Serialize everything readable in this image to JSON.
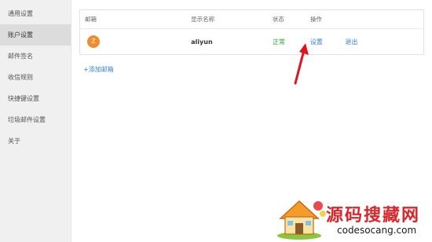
{
  "sidebar": {
    "items": [
      {
        "label": "通用设置"
      },
      {
        "label": "账户设置"
      },
      {
        "label": "邮件签名"
      },
      {
        "label": "收信规则"
      },
      {
        "label": "快捷键设置"
      },
      {
        "label": "垃圾邮件设置"
      },
      {
        "label": "关于"
      }
    ],
    "active_index": 1
  },
  "accounts_table": {
    "headers": {
      "email": "邮箱",
      "display_name": "显示名称",
      "status": "状态",
      "actions": "操作"
    },
    "rows": [
      {
        "avatar_letter": "Z",
        "avatar_color": "#f08c2e",
        "display_name": "aliyun",
        "status": "正常",
        "settings_label": "设置",
        "logout_label": "退出"
      }
    ]
  },
  "add_mailbox_label": "+添加邮箱",
  "watermark": {
    "title": "源码搜藏网",
    "url": "codesocang.com"
  },
  "colors": {
    "link": "#3a82d6",
    "status_ok": "#2aa22a",
    "annotation_arrow": "#e0141c",
    "watermark_red": "#d8262a"
  }
}
